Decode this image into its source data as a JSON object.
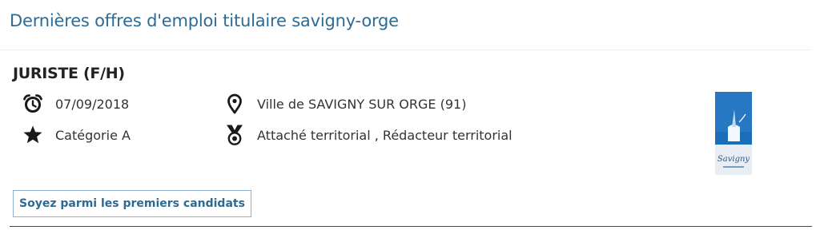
{
  "section": {
    "title": "Dernières offres d'emploi titulaire savigny-orge"
  },
  "job": {
    "title": "JURISTE (F/H)",
    "date": "07/09/2018",
    "location": "Ville de SAVIGNY SUR ORGE (91)",
    "category": "Catégorie A",
    "grades": "Attaché territorial , Rédacteur territorial",
    "apply_label": "Soyez parmi les premiers candidats",
    "logo_text": "Savigny",
    "icons": {
      "date": "alarm-clock-icon",
      "location": "map-pin-icon",
      "category": "star-icon",
      "grades": "medal-icon"
    }
  },
  "colors": {
    "accent": "#2e6b93",
    "logo_blue": "#1a6fb8"
  }
}
